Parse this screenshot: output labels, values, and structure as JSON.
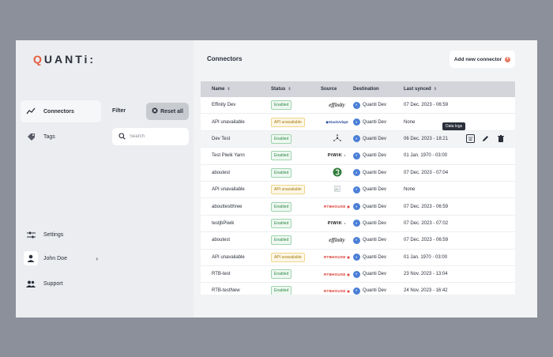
{
  "app": {
    "logo": "QUANTi:"
  },
  "sidebar": {
    "items": [
      {
        "label": "Connectors",
        "icon": "chart-line-icon"
      },
      {
        "label": "Tags",
        "icon": "tag-icon"
      }
    ],
    "bottom": {
      "settings": "Settings",
      "user": "John Doe",
      "support": "Support"
    }
  },
  "filter": {
    "label": "Filter",
    "reset": "Reset all",
    "search_placeholder": "Search"
  },
  "header": {
    "title": "Connectors",
    "add_button": "Add new connector"
  },
  "table": {
    "columns": [
      "Name",
      "Status",
      "Source",
      "Destination",
      "Last synced"
    ],
    "rows": [
      {
        "name": "Effinity Dev",
        "status": "Enabled",
        "source": "effinity",
        "destination": "Quanti Dev",
        "last": "07 Dec. 2023 - 06:59"
      },
      {
        "name": "API unavailable",
        "status": "API unavailable",
        "source": "StackAdapt",
        "destination": "Quanti Dev",
        "last": "None"
      },
      {
        "name": "Dev Test",
        "status": "Enabled",
        "source": "",
        "destination": "Quanti Dev",
        "last": "06 Dec. 2023 - 18:21"
      },
      {
        "name": "Test Piwik Yann",
        "status": "Enabled",
        "source": "PIWIK",
        "destination": "Quanti Dev",
        "last": "01 Jan. 1970 - 03:00"
      },
      {
        "name": "aboutest",
        "status": "Enabled",
        "source": "",
        "destination": "Quanti Dev",
        "last": "07 Dec. 2023 - 07:04"
      },
      {
        "name": "API unavailable",
        "status": "API unavailable",
        "source": "",
        "destination": "Quanti Dev",
        "last": "None"
      },
      {
        "name": "abouttestthree",
        "status": "Enabled",
        "source": "RTBHOUSE",
        "destination": "Quanti Dev",
        "last": "07 Dec. 2023 - 06:59"
      },
      {
        "name": "testjbPiwik",
        "status": "Enabled",
        "source": "PIWIK",
        "destination": "Quanti Dev",
        "last": "07 Dec. 2023 - 07:02"
      },
      {
        "name": "aboutest",
        "status": "Enabled",
        "source": "effinity",
        "destination": "Quanti Dev",
        "last": "07 Dec. 2023 - 06:59"
      },
      {
        "name": "API unavailable",
        "status": "API unavailable",
        "source": "RTBHOUSE",
        "destination": "Quanti Dev",
        "last": "01 Jan. 1970 - 03:00"
      },
      {
        "name": "RTB-test",
        "status": "Enabled",
        "source": "RTBHOUSE",
        "destination": "Quanti Dev",
        "last": "23 Nov. 2023 - 13:04"
      },
      {
        "name": "RTB-testNew",
        "status": "Enabled",
        "source": "RTBHOUSE",
        "destination": "Quanti Dev",
        "last": "24 Nov. 2023 - 16:42"
      }
    ]
  },
  "tooltip": {
    "label": "Data logs"
  },
  "colors": {
    "accent": "#e55a3c",
    "enabled": "#2f8a46",
    "warning": "#a67a0c",
    "destination": "#4a7fd6"
  }
}
